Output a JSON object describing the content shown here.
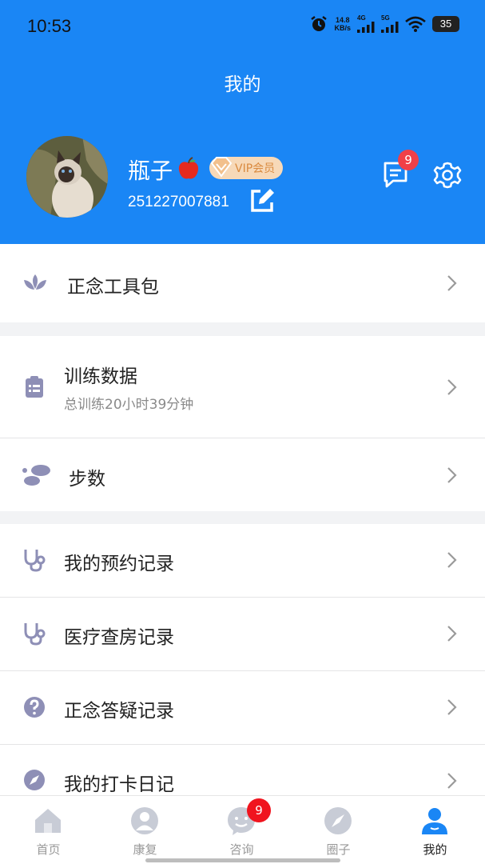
{
  "status_bar": {
    "time": "10:53",
    "net_speed_value": "14.8",
    "net_speed_unit": "KB/s",
    "signal_1": "4G",
    "signal_2": "5G",
    "battery": "35",
    "icons": [
      "alarm-icon",
      "signal-icon",
      "signal-icon",
      "wifi-icon",
      "battery-icon"
    ]
  },
  "header": {
    "title": "我的",
    "username": "瓶子",
    "vip_label": "VIP会员",
    "user_id": "251227007881",
    "message_badge": "9",
    "accent_color": "#1a86f5"
  },
  "menu": {
    "toolkit": {
      "label": "正念工具包",
      "icon": "lotus-icon"
    },
    "training": {
      "label": "训练数据",
      "subtitle": "总训练20小时39分钟",
      "icon": "clipboard-icon"
    },
    "steps": {
      "label": "步数",
      "icon": "footprints-icon"
    },
    "appointments": {
      "label": "我的预约记录",
      "icon": "stethoscope-icon"
    },
    "rounds": {
      "label": "医疗查房记录",
      "icon": "stethoscope-icon"
    },
    "qa": {
      "label": "正念答疑记录",
      "icon": "question-icon"
    },
    "diary": {
      "label": "我的打卡日记",
      "icon": "compass-icon"
    }
  },
  "tabbar": {
    "tabs": [
      {
        "label": "首页",
        "icon": "home-icon"
      },
      {
        "label": "康复",
        "icon": "person-icon"
      },
      {
        "label": "咨询",
        "icon": "chat-face-icon"
      },
      {
        "label": "圈子",
        "icon": "compass-icon"
      },
      {
        "label": "我的",
        "icon": "profile-icon"
      }
    ],
    "consult_badge": "9",
    "active": "我的"
  }
}
